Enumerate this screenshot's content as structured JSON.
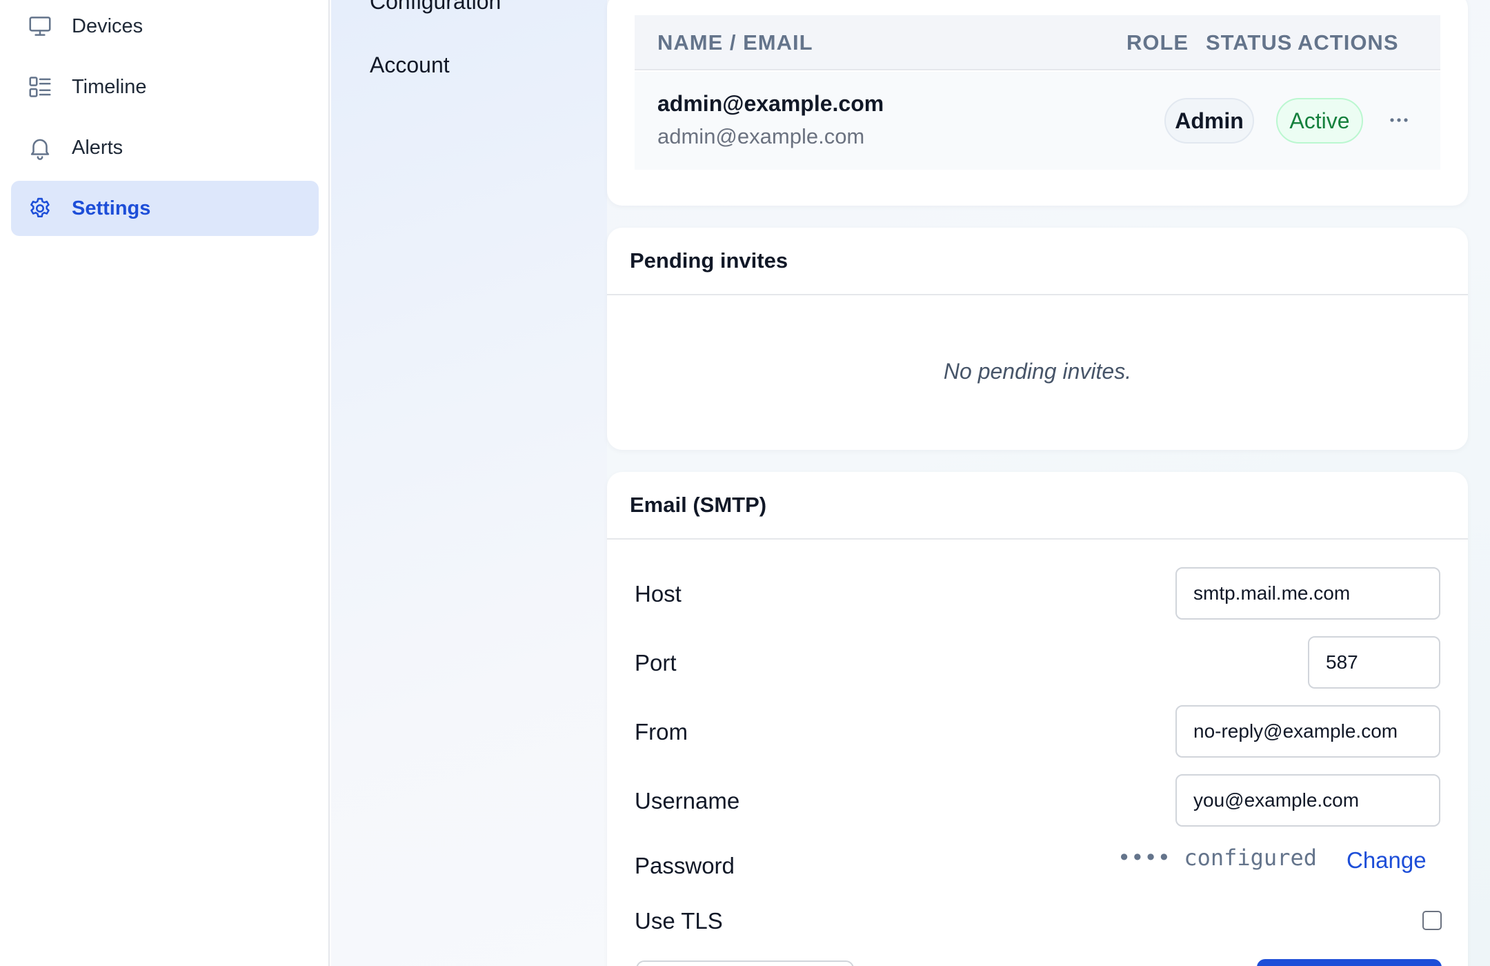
{
  "sidebar": {
    "items": [
      {
        "label": "Devices",
        "icon": "monitor-icon",
        "active": false
      },
      {
        "label": "Timeline",
        "icon": "timeline-list-icon",
        "active": false
      },
      {
        "label": "Alerts",
        "icon": "bell-icon",
        "active": false
      },
      {
        "label": "Settings",
        "icon": "gear-icon",
        "active": true
      }
    ]
  },
  "subnav": {
    "items": [
      {
        "label": "Configuration"
      },
      {
        "label": "Account"
      }
    ]
  },
  "users": {
    "columns": {
      "name_email": "NAME / EMAIL",
      "role": "ROLE",
      "status": "STATUS",
      "actions": "ACTIONS"
    },
    "rows": [
      {
        "name": "admin@example.com",
        "email": "admin@example.com",
        "role": "Admin",
        "status": "Active",
        "actions_icon": "more-horizontal-icon"
      }
    ]
  },
  "pending_invites": {
    "title": "Pending invites",
    "empty_message": "No pending invites."
  },
  "smtp": {
    "title": "Email (SMTP)",
    "host_label": "Host",
    "host_value": "smtp.mail.me.com",
    "port_label": "Port",
    "port_value": "587",
    "from_label": "From",
    "from_value": "no-reply@example.com",
    "username_label": "Username",
    "username_value": "you@example.com",
    "password_label": "Password",
    "password_mask": "•••• configured",
    "password_change_label": "Change",
    "tls_label": "Use TLS",
    "tls_checked": false
  },
  "colors": {
    "accent": "#1d4ed8",
    "active_nav_bg": "#dde7fb",
    "status_active": "#15803d",
    "status_active_bg": "#ecfdf3"
  }
}
